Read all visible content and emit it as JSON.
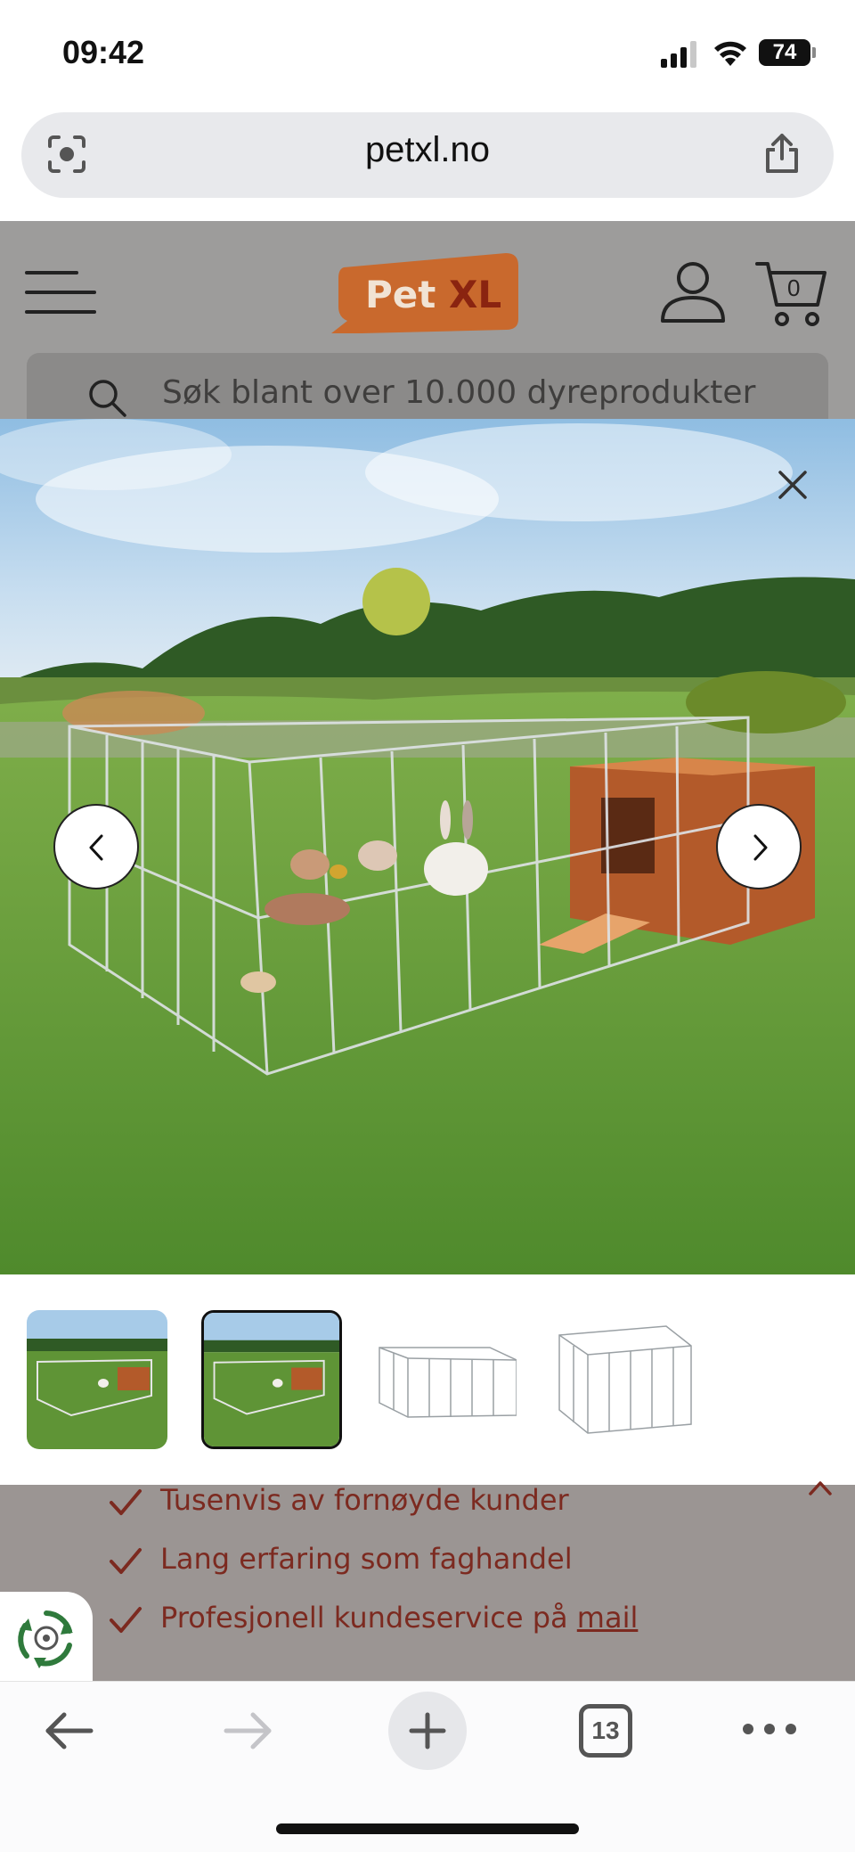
{
  "status_bar": {
    "time": "09:42",
    "battery": "74",
    "icons": [
      "signal-icon",
      "wifi-icon",
      "battery-icon"
    ]
  },
  "browser": {
    "url": "petxl.no",
    "tab_count": "13",
    "icons": [
      "lens-icon",
      "share-icon",
      "back-icon",
      "forward-icon",
      "new-tab-icon",
      "more-icon"
    ]
  },
  "site": {
    "logo_pet": "Pet",
    "logo_xl": "XL",
    "cart_count": "0",
    "search_placeholder": "Søk blant over 10.000 dyreprodukter"
  },
  "lightbox": {
    "image_count": 4,
    "active_index": 1,
    "icons": [
      "close-icon",
      "chevron-left-icon",
      "chevron-right-icon"
    ]
  },
  "benefits": {
    "items": [
      {
        "text": "Tusenvis av fornøyde kunder"
      },
      {
        "text": "Lang erfaring som faghandel"
      },
      {
        "text": "Profesjonell kundeservice på ",
        "link": "mail"
      }
    ]
  },
  "colors": {
    "brand_orange": "#d8691e",
    "brand_dark_red": "#8a2410",
    "benefit_text": "#7c2a20",
    "overlay_gray": "#9d9c9b"
  }
}
